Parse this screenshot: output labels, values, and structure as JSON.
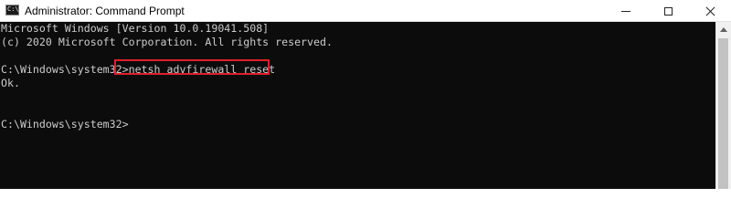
{
  "window": {
    "title": "Administrator: Command Prompt",
    "icon": "command-prompt-icon",
    "icon_glyph": "C:\\",
    "controls": {
      "minimize_icon": "minimize-icon",
      "maximize_icon": "maximize-icon",
      "close_icon": "close-icon"
    }
  },
  "console": {
    "lines": [
      "Microsoft Windows [Version 10.0.19041.508]",
      "(c) 2020 Microsoft Corporation. All rights reserved.",
      "",
      "C:\\Windows\\system32>netsh advfirewall reset",
      "Ok.",
      "",
      "",
      "C:\\Windows\\system32>"
    ],
    "highlighted_command": "netsh advfirewall reset",
    "colors": {
      "background": "#0c0c0c",
      "text": "#cccccc",
      "highlight_border": "#e0202a"
    }
  }
}
